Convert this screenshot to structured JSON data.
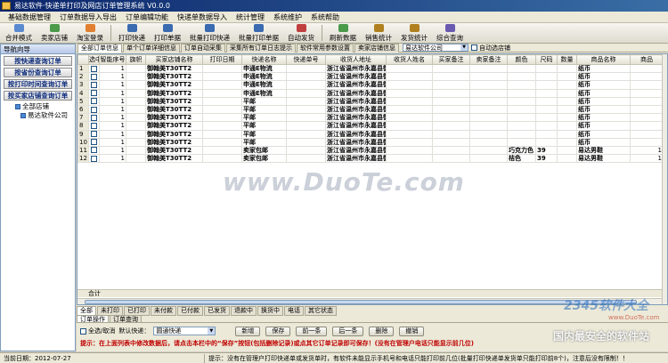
{
  "window": {
    "title": "易达软件·快递单打印及网店订单管理系统  V0.0.0"
  },
  "menu": [
    "基础数据管理",
    "订单数据导入导出",
    "订单编辑功能",
    "快递单数据导入",
    "统计管理",
    "系统维护",
    "系统帮助"
  ],
  "toolbar": [
    {
      "label": "合并模式",
      "icon": "merge-icon",
      "color": "#5a8ad0"
    },
    {
      "label": "卖家店铺",
      "icon": "shop-icon",
      "color": "#4a9a4a"
    },
    {
      "label": "淘宝登录",
      "icon": "taobao-icon",
      "color": "#e08030"
    },
    {
      "label": "打印快递",
      "icon": "print-express-icon",
      "color": "#3a6ab0"
    },
    {
      "label": "打印单据",
      "icon": "print-doc-icon",
      "color": "#3a6ab0"
    },
    {
      "label": "批量打印快递",
      "icon": "batch-print-icon",
      "color": "#3a6ab0"
    },
    {
      "label": "批量打印单据",
      "icon": "batch-print-doc-icon",
      "color": "#3a6ab0"
    },
    {
      "label": "自动发货",
      "icon": "auto-ship-icon",
      "color": "#c04040"
    },
    {
      "label": "刷新数据",
      "icon": "refresh-icon",
      "color": "#4a9a4a"
    },
    {
      "label": "销售统计",
      "icon": "sales-stats-icon",
      "color": "#b08020"
    },
    {
      "label": "发货统计",
      "icon": "ship-stats-icon",
      "color": "#b08020"
    },
    {
      "label": "综合查询",
      "icon": "query-icon",
      "color": "#6a5ab0"
    }
  ],
  "sidebar": {
    "header": "导航向导",
    "buttons": [
      "按快递查询订单",
      "按省份查询订单",
      "按打印时间查询订单",
      "按买家店铺查询订单"
    ],
    "tree": [
      "全部店铺",
      "易达软件公司"
    ]
  },
  "subtabs": [
    "全部订单信息",
    "单个订单详细信息",
    "订单自动采集",
    "采集所有订单日志提示",
    "软件常用参数设置",
    "卖家店铺信息"
  ],
  "shop_select": "易达软件公司",
  "auto_fill_label": "自动选店铺",
  "grid": {
    "columns": [
      "选中",
      "智能序号",
      "旗帜",
      "买家店铺名称",
      "打印日期",
      "快递名称",
      "快递单号",
      "收货人地址",
      "收货人姓名",
      "买家备注",
      "卖家备注",
      "颜色",
      "尺码",
      "数量",
      "商品名称",
      "商品"
    ],
    "rows": [
      {
        "no": "1",
        "seq": "1",
        "shop": "御翰美T30TT2",
        "courier": "申通E物流",
        "addr": "浙江省温州市永嘉县御翰美",
        "color": "",
        "size": "",
        "qty": "",
        "goods": "纸币",
        "extra": ""
      },
      {
        "no": "2",
        "seq": "1",
        "shop": "御翰美T30TT2",
        "courier": "申通E物流",
        "addr": "浙江省温州市永嘉县御翰美",
        "color": "",
        "size": "",
        "qty": "",
        "goods": "纸币",
        "extra": ""
      },
      {
        "no": "3",
        "seq": "1",
        "shop": "御翰美T30TT2",
        "courier": "申通E物流",
        "addr": "浙江省温州市永嘉县御翰美",
        "color": "",
        "size": "",
        "qty": "",
        "goods": "纸币",
        "extra": ""
      },
      {
        "no": "4",
        "seq": "1",
        "shop": "御翰美T30TT2",
        "courier": "申通E物流",
        "addr": "浙江省温州市永嘉县御翰美",
        "color": "",
        "size": "",
        "qty": "",
        "goods": "纸币",
        "extra": ""
      },
      {
        "no": "5",
        "seq": "1",
        "shop": "御翰美T30TT2",
        "courier": "平邮",
        "addr": "浙江省温州市永嘉县御翰美",
        "color": "",
        "size": "",
        "qty": "",
        "goods": "纸币",
        "extra": ""
      },
      {
        "no": "6",
        "seq": "1",
        "shop": "御翰美T30TT2",
        "courier": "平邮",
        "addr": "浙江省温州市永嘉县御翰美",
        "color": "",
        "size": "",
        "qty": "",
        "goods": "纸币",
        "extra": ""
      },
      {
        "no": "7",
        "seq": "1",
        "shop": "御翰美T30TT2",
        "courier": "平邮",
        "addr": "浙江省温州市永嘉县御翰美",
        "color": "",
        "size": "",
        "qty": "",
        "goods": "纸币",
        "extra": ""
      },
      {
        "no": "8",
        "seq": "1",
        "shop": "御翰美T30TT2",
        "courier": "平邮",
        "addr": "浙江省温州市永嘉县御翰美",
        "color": "",
        "size": "",
        "qty": "",
        "goods": "纸币",
        "extra": ""
      },
      {
        "no": "9",
        "seq": "1",
        "shop": "御翰美T30TT2",
        "courier": "平邮",
        "addr": "浙江省温州市永嘉县御翰美",
        "color": "",
        "size": "",
        "qty": "",
        "goods": "纸币",
        "extra": ""
      },
      {
        "no": "10",
        "seq": "1",
        "shop": "御翰美T30TT2",
        "courier": "平邮",
        "addr": "浙江省温州市永嘉县御翰美",
        "color": "",
        "size": "",
        "qty": "",
        "goods": "纸币",
        "extra": ""
      },
      {
        "no": "11",
        "seq": "1",
        "shop": "御翰美T30TT2",
        "courier": "卖家包邮",
        "addr": "浙江省温州市永嘉县御翰美",
        "color": "巧克力色",
        "size": "39",
        "qty": "",
        "goods": "易达男鞋",
        "extra": "1"
      },
      {
        "no": "12",
        "seq": "1",
        "shop": "御翰美T30TT2",
        "courier": "卖家包邮",
        "addr": "浙江省温州市永嘉县御翰美",
        "color": "桔色",
        "size": "39",
        "qty": "",
        "goods": "易达男鞋",
        "extra": "1"
      }
    ],
    "footer": "合计"
  },
  "status_tabs": [
    "全部",
    "未打印",
    "已打印",
    "未付款",
    "已付款",
    "已发货",
    "退款中",
    "换货中",
    "电话",
    "其它状态"
  ],
  "bottom_tabs": [
    "订单操作",
    "订单查询"
  ],
  "actions": {
    "select_all": "全选/取消",
    "default_courier_label": "默认快递：",
    "default_courier": "圆通快递",
    "buttons": [
      "新增",
      "保存",
      "前一条",
      "后一条",
      "删除",
      "撤销"
    ]
  },
  "hint": "提示：在上面列表中修改数据后，请点击本栏中的“保存”按钮(包括删除记录)或点其它订单记录即可保存！(没有在管理户电话只能显示前几位)",
  "statusbar": {
    "date": "当前日期：2012-07-27",
    "message": "提示：没有在管理户打印快递单或发货单时，有软件未能显示手机号和电话只能打印前几位(批量打印快递单发货单只能打印前8个)，注意后没有限制！！"
  },
  "watermark": "www.DuoTe.com",
  "watermark_logo": {
    "top": "2345软件大全",
    "url": "www.DuoTe.com",
    "bottom": "国内最安全的软件站"
  }
}
